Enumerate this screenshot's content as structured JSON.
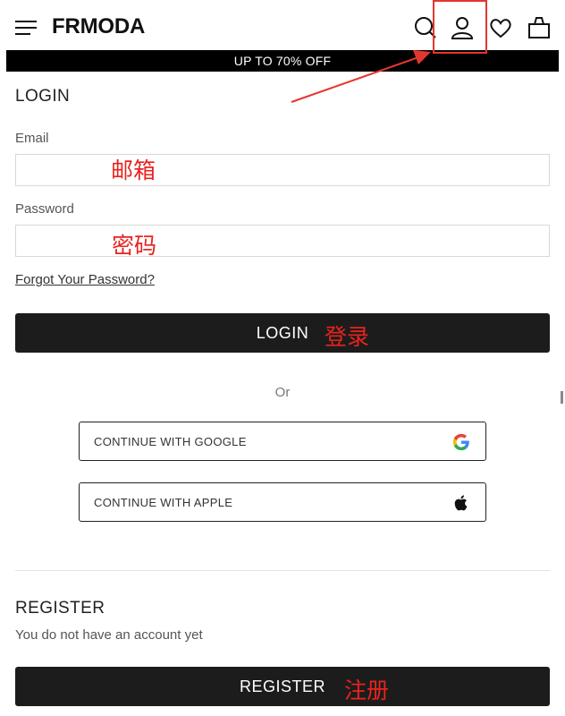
{
  "header": {
    "logo": "FRMODA",
    "icons": [
      "menu-icon",
      "search-icon",
      "user-icon",
      "heart-icon",
      "bag-icon"
    ]
  },
  "banner": {
    "text": "UP TO 70% OFF"
  },
  "login": {
    "title": "LOGIN",
    "email_label": "Email",
    "email_value": "",
    "password_label": "Password",
    "password_value": "",
    "forgot": "Forgot Your Password?",
    "button": "LOGIN",
    "or": "Or",
    "google": "CONTINUE WITH GOOGLE",
    "apple": "CONTINUE WITH APPLE"
  },
  "register": {
    "title": "REGISTER",
    "subtitle": "You do not have an account yet",
    "button": "REGISTER"
  },
  "annotations": {
    "email": "邮箱",
    "password": "密码",
    "login": "登录",
    "register": "注册",
    "color": "#e8231f"
  },
  "colors": {
    "button_bg": "#1d1c1c",
    "banner_bg": "#000000",
    "annotation_red": "#e5352f"
  }
}
